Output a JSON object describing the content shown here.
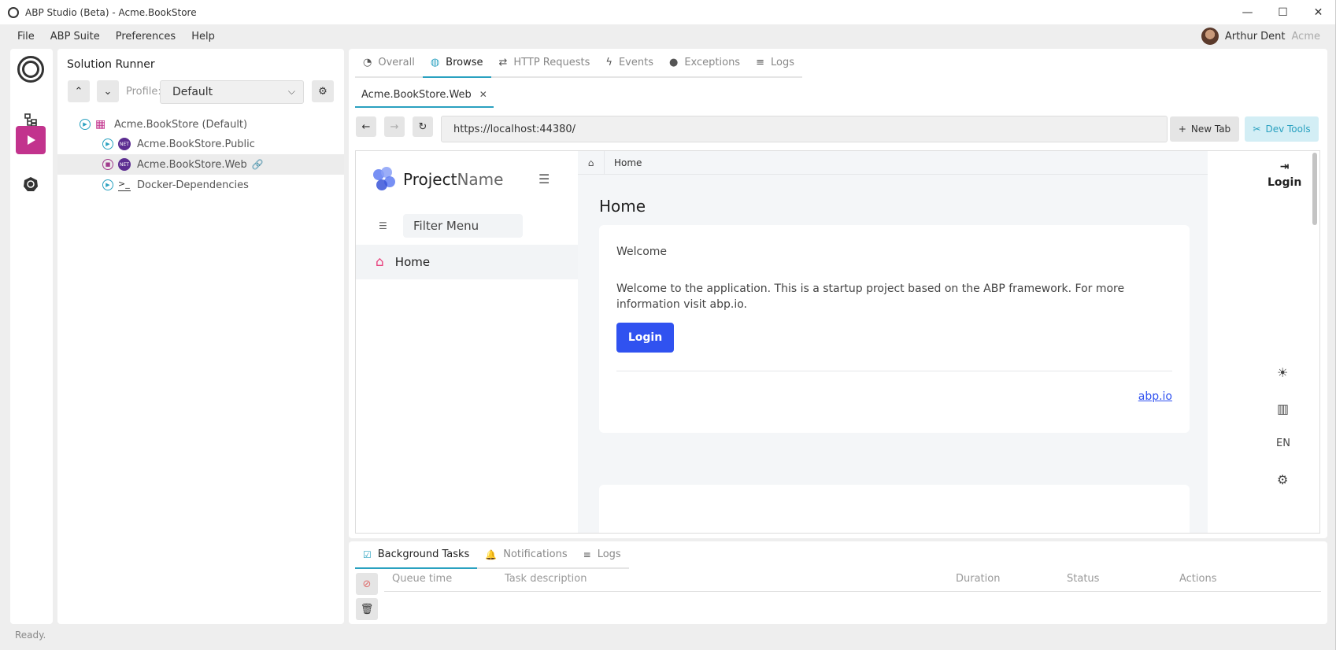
{
  "window": {
    "title": "ABP Studio (Beta) - Acme.BookStore",
    "minimize": "—",
    "maximize": "☐",
    "close": "✕"
  },
  "menu": {
    "items": [
      "File",
      "ABP Suite",
      "Preferences",
      "Help"
    ],
    "user_name": "Arthur Dent",
    "org": "Acme"
  },
  "rail": {
    "icons": [
      "abp-logo-icon",
      "solution-explorer-icon",
      "play-icon",
      "kubernetes-icon"
    ],
    "active_color": "#c2338d"
  },
  "runner": {
    "title": "Solution Runner",
    "profile_label": "Profile:",
    "profile_value": "Default",
    "tree": [
      {
        "label": "Acme.BookStore (Default)",
        "state": "stopped",
        "kind": "solution"
      },
      {
        "label": "Acme.BookStore.Public",
        "state": "stopped",
        "kind": "dotnet"
      },
      {
        "label": "Acme.BookStore.Web",
        "state": "running",
        "kind": "dotnet"
      },
      {
        "label": "Docker-Dependencies",
        "state": "stopped",
        "kind": "terminal"
      }
    ]
  },
  "main": {
    "tabs": [
      {
        "label": "Overall",
        "icon": "gauge-icon"
      },
      {
        "label": "Browse",
        "icon": "globe-icon"
      },
      {
        "label": "HTTP Requests",
        "icon": "arrows-icon"
      },
      {
        "label": "Events",
        "icon": "bolt-icon"
      },
      {
        "label": "Exceptions",
        "icon": "alert-icon"
      },
      {
        "label": "Logs",
        "icon": "list-icon"
      }
    ],
    "active_tab": "Browse",
    "subtab": "Acme.BookStore.Web",
    "url": "https://localhost:44380/",
    "new_tab": "New Tab",
    "dev_tools": "Dev Tools",
    "accent": "#2aa1c0"
  },
  "web": {
    "brand_bold": "Project",
    "brand_light": "Name",
    "filter_placeholder": "Filter Menu",
    "nav_home": "Home",
    "breadcrumb": "Home",
    "page_title": "Home",
    "card_title": "Welcome",
    "card_text": "Welcome to the application. This is a startup project based on the ABP framework. For more information visit abp.io.",
    "login_button": "Login",
    "link": "abp.io",
    "right_login": "Login",
    "language": "EN",
    "button_color": "#3052f0"
  },
  "bottom": {
    "tabs": [
      {
        "label": "Background Tasks",
        "icon": "tasks-icon"
      },
      {
        "label": "Notifications",
        "icon": "bell-icon"
      },
      {
        "label": "Logs",
        "icon": "list-icon"
      }
    ],
    "columns": [
      "Queue time",
      "Task description",
      "Duration",
      "Status",
      "Actions"
    ]
  },
  "status": "Ready."
}
